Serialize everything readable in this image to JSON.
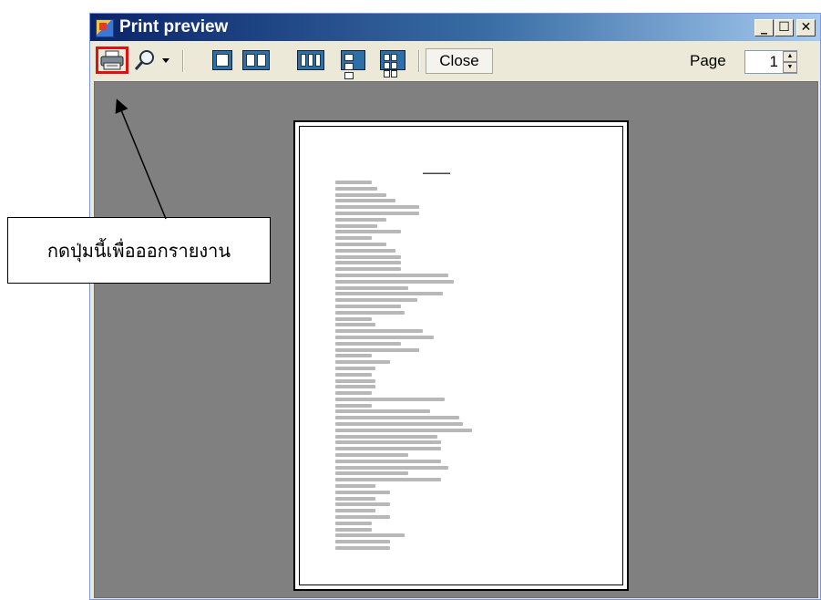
{
  "window": {
    "title": "Print preview",
    "buttons": {
      "minimize": "_",
      "maximize": "☐",
      "close": "✕"
    }
  },
  "toolbar": {
    "print_icon": "printer-icon",
    "zoom_icon": "magnifier-icon",
    "zoom_dropdown_icon": "caret-down-icon",
    "layouts": [
      "one-page",
      "two-pages",
      "three-pages",
      "four-pages",
      "six-pages"
    ],
    "close_label": "Close",
    "page_label": "Page",
    "page_value": "1"
  },
  "annotation": {
    "text": "กดปุ่มนี้เพื่อออกรายงาน",
    "highlight_color": "#e01010"
  },
  "colors": {
    "title_bar": "#0a246a",
    "preview_background": "#808080"
  }
}
